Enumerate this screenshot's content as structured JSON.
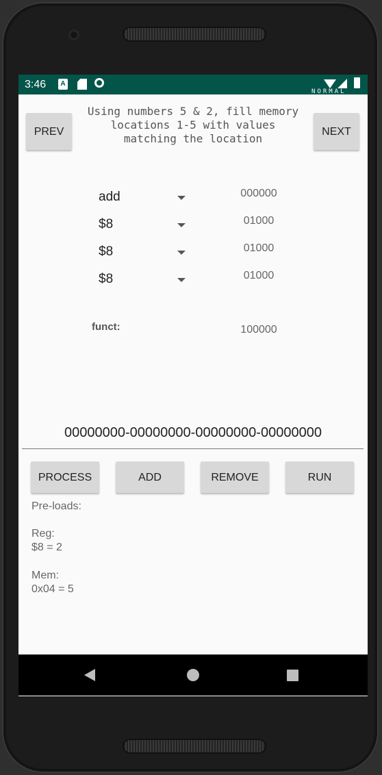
{
  "status_bar": {
    "time": "3:46",
    "notification_icons": [
      "a-badge-icon",
      "sd-card-icon",
      "sync-icon"
    ],
    "carrier": "NORMAL",
    "system_icons": [
      "wifi-icon",
      "cell-signal-icon",
      "battery-icon"
    ],
    "background_color": "#03554a"
  },
  "header": {
    "prev_label": "PREV",
    "next_label": "NEXT",
    "instruction": "Using numbers 5 & 2, fill memory locations 1-5 with values matching the location"
  },
  "instruction_fields": [
    {
      "selected": "add",
      "binary": "000000"
    },
    {
      "selected": "$8",
      "binary": "01000"
    },
    {
      "selected": "$8",
      "binary": "01000"
    },
    {
      "selected": "$8",
      "binary": "01000"
    }
  ],
  "funct": {
    "label": "funct:",
    "binary": "100000"
  },
  "machine_code": "00000000-00000000-00000000-00000000",
  "actions": {
    "process": "PROCESS",
    "add": "ADD",
    "remove": "REMOVE",
    "run": "RUN"
  },
  "preloads": {
    "title": "Pre-loads:",
    "reg_label": "Reg:",
    "reg_value": "$8 = 2",
    "mem_label": "Mem:",
    "mem_value": "0x04 = 5"
  },
  "nav": {
    "icons": [
      "back-icon",
      "home-icon",
      "recents-icon"
    ]
  }
}
